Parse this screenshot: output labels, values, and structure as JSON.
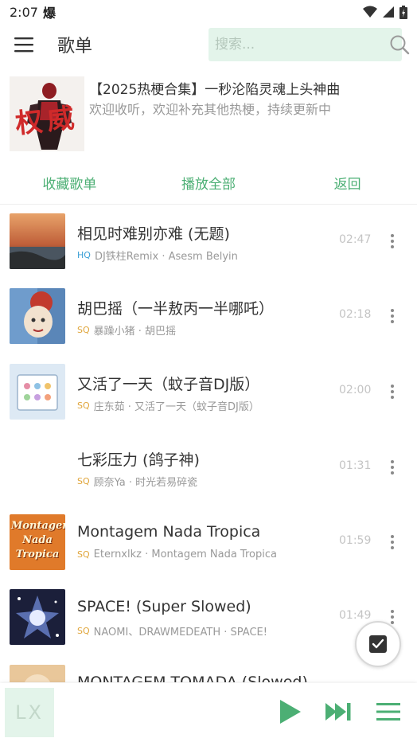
{
  "status_bar": {
    "time": "2:07",
    "extra": "爆"
  },
  "app_bar": {
    "title": "歌单",
    "search_placeholder": "搜索..."
  },
  "playlist": {
    "title": "【2025热梗合集】一秒沦陷灵魂上头神曲",
    "description": "欢迎收听，欢迎补充其他热梗，持续更新中",
    "cover_text": "权威"
  },
  "actions": {
    "collect": "收藏歌单",
    "play_all": "播放全部",
    "back": "返回"
  },
  "songs": [
    {
      "name": "相见时难别亦难 (无题)",
      "quality": "HQ",
      "artist_album": "DJ铁柱Remix · Asesm Belyin",
      "duration": "02:47"
    },
    {
      "name": "胡巴摇（一半敖丙一半哪吒）",
      "quality": "SQ",
      "artist_album": "暴躁小猪 · 胡巴摇",
      "duration": "02:18"
    },
    {
      "name": "又活了一天（蚊子音DJ版）",
      "quality": "SQ",
      "artist_album": "庄东茹 · 又活了一天（蚊子音DJ版）",
      "duration": "02:00"
    },
    {
      "name": "七彩压力 (鸽子神)",
      "quality": "SQ",
      "artist_album": "顾奈Ya · 时光若易碎瓷",
      "duration": "01:31"
    },
    {
      "name": "Montagem Nada Tropica",
      "quality": "SQ",
      "artist_album": "Eternxlkz · Montagem Nada Tropica",
      "duration": "01:59",
      "cover_text": "Montagem Nada Tropica"
    },
    {
      "name": "SPACE! (Super Slowed)",
      "quality": "SQ",
      "artist_album": "NAOMI、DRAWMEDEATH · SPACE!",
      "duration": "01:49"
    },
    {
      "name": "MONTAGEM TOMADA (Slowed)",
      "quality": "",
      "artist_album": "",
      "duration": ""
    }
  ],
  "player": {
    "logo": "LX"
  },
  "colors": {
    "accent": "#4caf74",
    "search_bg": "#e3f4ea",
    "hq": "#3a9fd6",
    "sq": "#e0a53a"
  }
}
